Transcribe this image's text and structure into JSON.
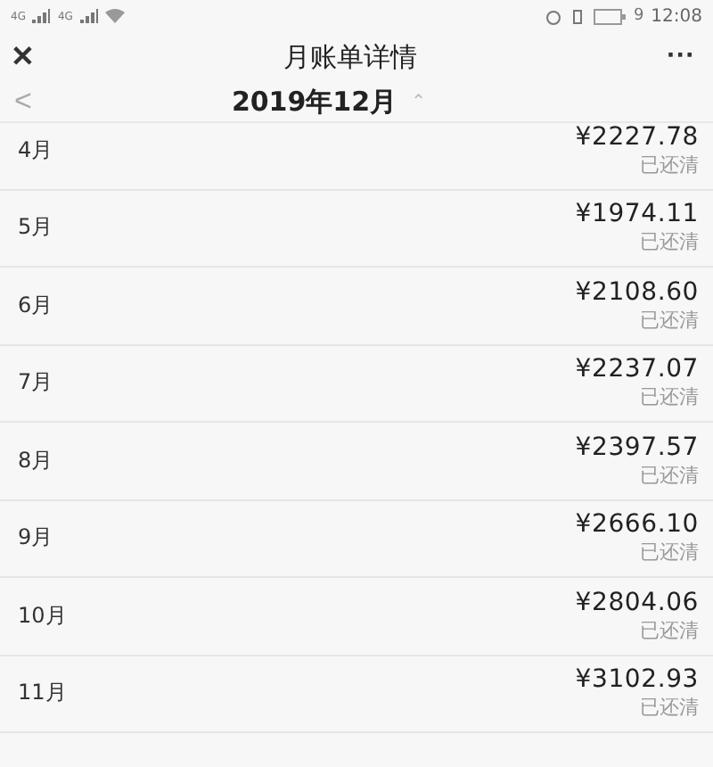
{
  "status_bar": {
    "network_labels": [
      "4G",
      "4G"
    ],
    "battery": "9",
    "time": "12:08"
  },
  "nav": {
    "close": "✕",
    "title": "月账单详情",
    "more": "···"
  },
  "month_picker": {
    "prev": "<",
    "month": "2019年12月",
    "caret": "⌃"
  },
  "bills": [
    {
      "month": "4月",
      "amount": "¥2227.78",
      "status": "已还清"
    },
    {
      "month": "5月",
      "amount": "¥1974.11",
      "status": "已还清"
    },
    {
      "month": "6月",
      "amount": "¥2108.60",
      "status": "已还清"
    },
    {
      "month": "7月",
      "amount": "¥2237.07",
      "status": "已还清"
    },
    {
      "month": "8月",
      "amount": "¥2397.57",
      "status": "已还清"
    },
    {
      "month": "9月",
      "amount": "¥2666.10",
      "status": "已还清"
    },
    {
      "month": "10月",
      "amount": "¥2804.06",
      "status": "已还清"
    },
    {
      "month": "11月",
      "amount": "¥3102.93",
      "status": "已还清"
    }
  ]
}
